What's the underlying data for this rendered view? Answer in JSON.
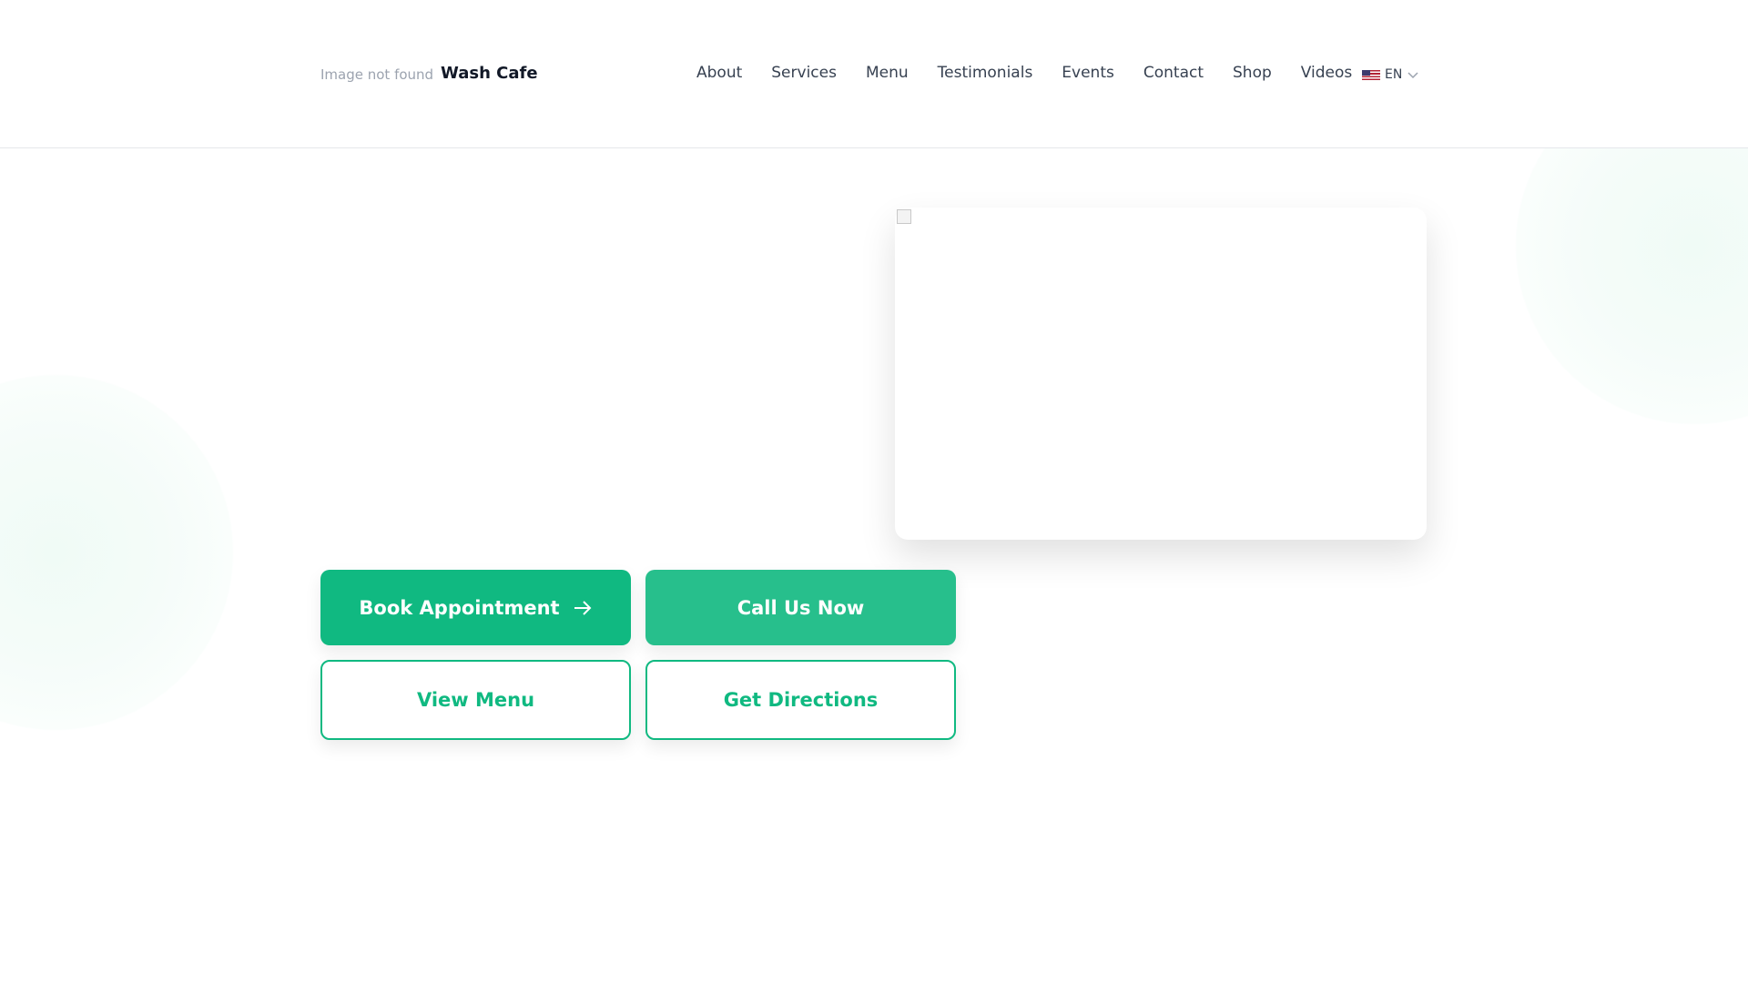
{
  "header": {
    "logo_alt": "Image not found",
    "brand": "Wash Cafe",
    "nav": [
      "About",
      "Services",
      "Menu",
      "Testimonials",
      "Events",
      "Contact",
      "Shop",
      "Videos"
    ],
    "language": "EN"
  },
  "hero": {
    "buttons": {
      "book": "Book Appointment",
      "call": "Call Us Now",
      "menu": "View Menu",
      "directions": "Get Directions"
    }
  },
  "colors": {
    "primary": "#10b981",
    "secondary": "#27bf8c"
  }
}
